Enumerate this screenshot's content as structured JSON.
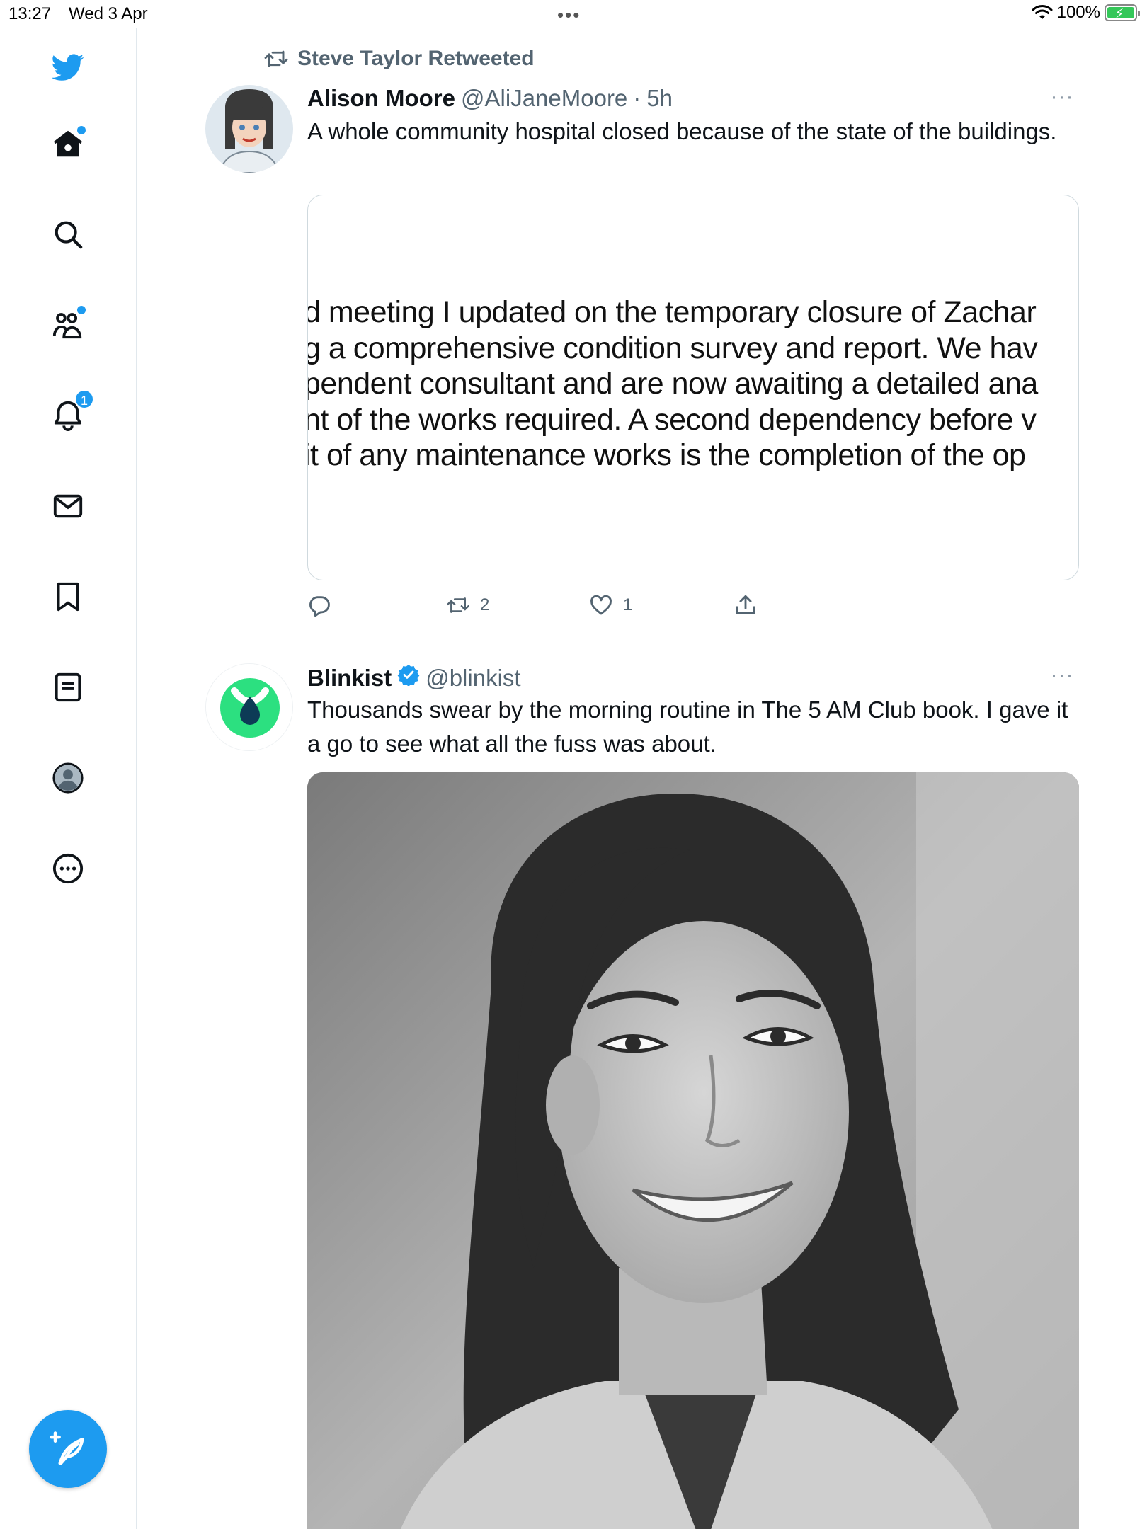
{
  "status_bar": {
    "time": "13:27",
    "date": "Wed 3 Apr",
    "battery": "100%"
  },
  "sidebar": {
    "notifications_badge": "1",
    "accent_color": "#1d9bf0",
    "items": [
      "twitter-logo",
      "home-icon",
      "search-icon",
      "communities-icon",
      "notifications-icon",
      "messages-icon",
      "bookmarks-icon",
      "lists-icon",
      "profile-icon",
      "more-icon"
    ]
  },
  "feed": {
    "tweets": [
      {
        "retweeted_by": "Steve Taylor Retweeted",
        "name": "Alison Moore",
        "handle": "@AliJaneMoore",
        "sep": "·",
        "time": "5h",
        "text": "A whole community hospital closed because of the state of the buildings.",
        "media_lines": [
          "d meeting I updated on the temporary closure of Zachar",
          "g a comprehensive condition survey and report. We hav",
          "pendent consultant and are now awaiting a detailed ana",
          "nt of the works required. A second dependency before v",
          "it of any maintenance works is the completion of the op"
        ],
        "reply_count": "",
        "retweet_count": "2",
        "like_count": "1"
      },
      {
        "name": "Blinkist",
        "handle": "@blinkist",
        "verified": true,
        "text": "Thousands swear by the morning routine in The 5 AM Club book. I gave it a go to see what all the fuss was about.",
        "brand_color": "#2ce080"
      }
    ]
  }
}
